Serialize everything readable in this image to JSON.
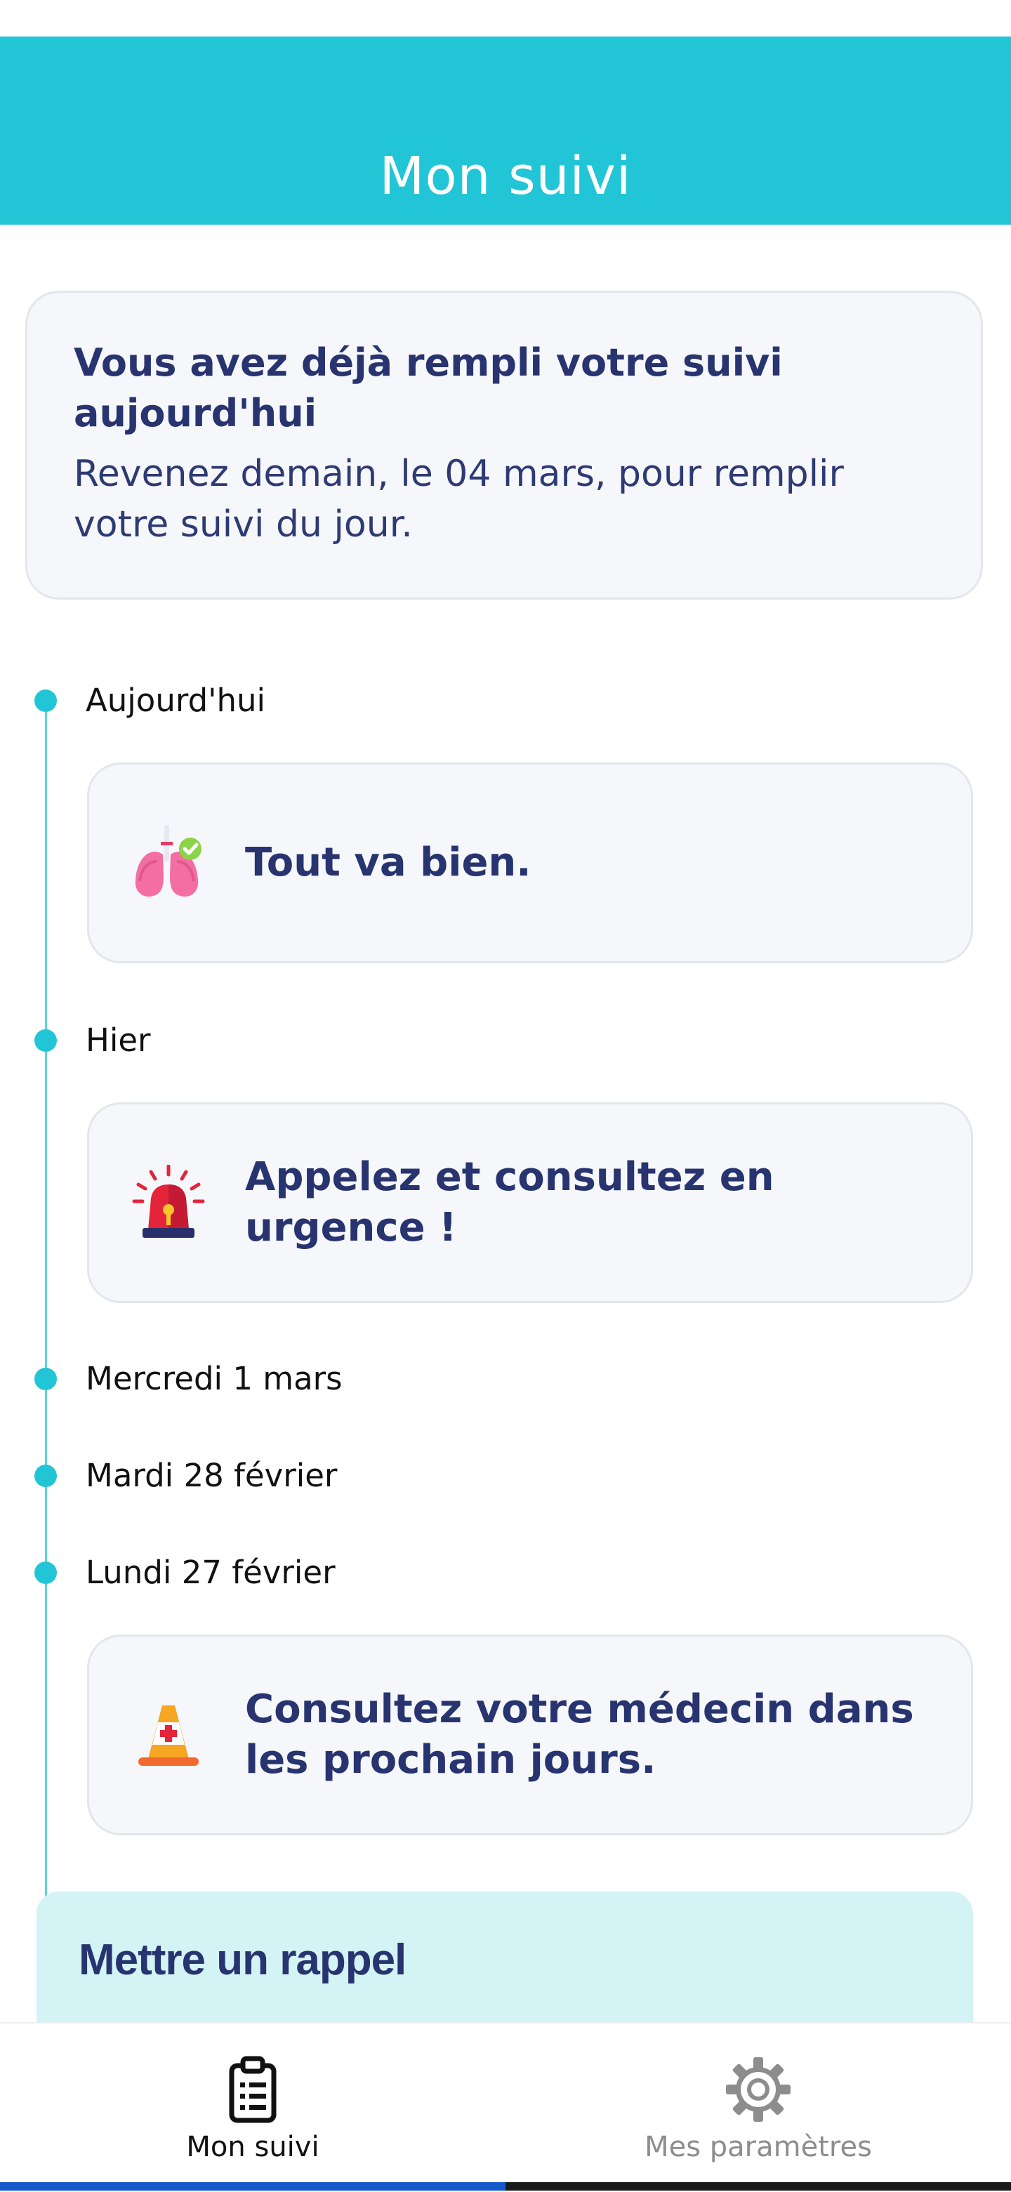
{
  "header": {
    "title": "Mon suivi",
    "color": "#22c5d6"
  },
  "info_card": {
    "title": "Vous avez déjà rempli votre suivi aujourd'hui",
    "text": "Revenez demain, le 04 mars, pour remplir votre suivi du jour."
  },
  "timeline": [
    {
      "date": "Aujourd'hui",
      "status": {
        "text": "Tout va bien.",
        "icon": "lungs-icon"
      }
    },
    {
      "date": "Hier",
      "status": {
        "text": "Appelez et consultez en urgence !",
        "icon": "siren-icon"
      }
    },
    {
      "date": "Mercredi 1 mars"
    },
    {
      "date": "Mardi 28 février"
    },
    {
      "date": "Lundi 27 février",
      "status": {
        "text": "Consultez votre médecin dans les prochain jours.",
        "icon": "medical-cone-icon"
      }
    }
  ],
  "reminder": {
    "title": "Mettre un rappel"
  },
  "bottom_nav": {
    "items": [
      {
        "label": "Mon suivi",
        "icon": "clipboard-icon",
        "active": true
      },
      {
        "label": "Mes paramètres",
        "icon": "gear-icon",
        "active": false
      }
    ]
  },
  "colors": {
    "accent": "#22c5d6",
    "text_dark": "#28346f",
    "card_bg": "#f6f7fa",
    "reminder_bg": "#d3f3f5"
  }
}
